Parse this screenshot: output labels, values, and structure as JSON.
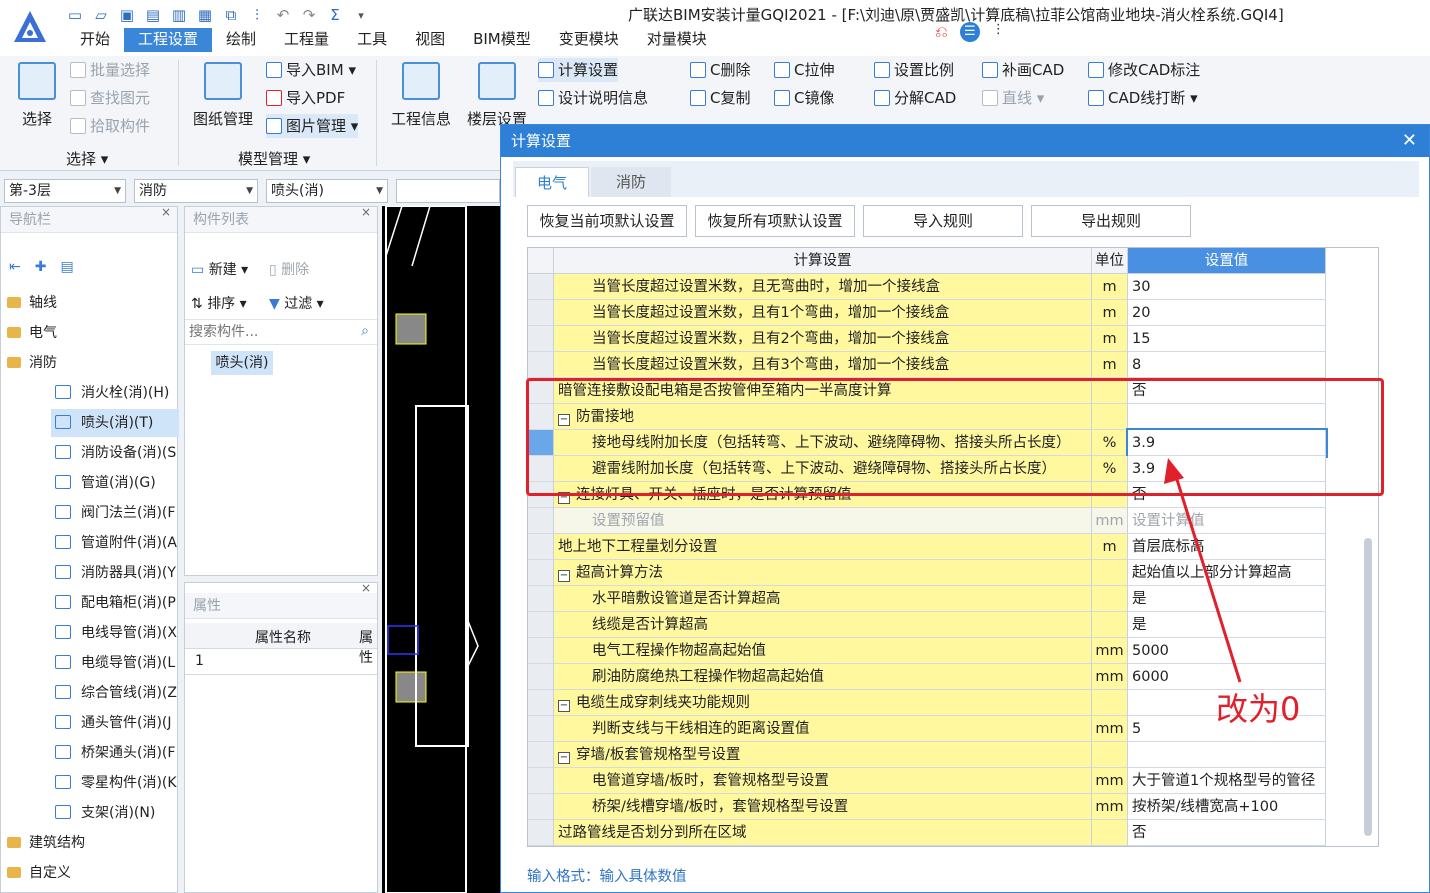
{
  "app": {
    "title": "广联达BIM安装计量GQI2021 - [F:\\刘迪\\原\\贾盛凯\\计算底稿\\拉菲公馆商业地块-消火栓系统.GQI4]",
    "menu_tabs": [
      "开始",
      "工程设置",
      "绘制",
      "工程量",
      "工具",
      "视图",
      "BIM模型",
      "变更模块",
      "对量模块"
    ]
  },
  "ribbon": {
    "select_group": {
      "big": "选择",
      "items": [
        "批量选择",
        "查找图元",
        "拾取构件"
      ],
      "label": "选择"
    },
    "model_group": {
      "big": "图纸管理",
      "items": [
        "导入BIM",
        "导入PDF",
        "图片管理"
      ],
      "label": "模型管理"
    },
    "info_buttons": [
      "工程信息",
      "楼层设置"
    ],
    "calc_items": [
      "计算设置",
      "设计说明信息"
    ],
    "cad_items": [
      "C删除",
      "C拉伸",
      "C复制",
      "C镜像"
    ],
    "scale_items": [
      "设置比例",
      "补画CAD",
      "修改CAD标注",
      "分解CAD",
      "直线",
      "CAD线打断"
    ]
  },
  "selectors": {
    "floor": "第-3层",
    "category": "消防",
    "component": "喷头(消)"
  },
  "nav": {
    "title": "导航栏",
    "folders": [
      "轴线",
      "电气",
      "消防",
      "建筑结构",
      "自定义"
    ],
    "items": [
      "消火栓(消)(H)",
      "喷头(消)(T)",
      "消防设备(消)(S",
      "管道(消)(G)",
      "阀门法兰(消)(F",
      "管道附件(消)(A",
      "消防器具(消)(Y",
      "配电箱柜(消)(P",
      "电线导管(消)(X",
      "电缆导管(消)(L",
      "综合管线(消)(Z",
      "通头管件(消)(J",
      "桥架通头(消)(F",
      "零星构件(消)(K",
      "支架(消)(N)"
    ]
  },
  "comp_list": {
    "title": "构件列表",
    "new": "新建",
    "delete": "删除",
    "sort": "排序",
    "filter": "过滤",
    "search_placeholder": "搜索构件...",
    "item": "喷头(消)"
  },
  "props": {
    "title": "属性",
    "col_name": "属性名称",
    "col_val": "属性",
    "row1": "1"
  },
  "dialog": {
    "title": "计算设置",
    "tabs": [
      "电气",
      "消防"
    ],
    "buttons": [
      "恢复当前项默认设置",
      "恢复所有项默认设置",
      "导入规则",
      "导出规则"
    ],
    "headers": [
      "计算设置",
      "单位",
      "设置值"
    ],
    "rows": [
      {
        "name": "当管长度超过设置米数，且无弯曲时，增加一个接线盒",
        "unit": "m",
        "value": "30",
        "indent": 2
      },
      {
        "name": "当管长度超过设置米数，且有1个弯曲，增加一个接线盒",
        "unit": "m",
        "value": "20",
        "indent": 2
      },
      {
        "name": "当管长度超过设置米数，且有2个弯曲，增加一个接线盒",
        "unit": "m",
        "value": "15",
        "indent": 2
      },
      {
        "name": "当管长度超过设置米数，且有3个弯曲，增加一个接线盒",
        "unit": "m",
        "value": "8",
        "indent": 2
      },
      {
        "name": "暗管连接敷设配电箱是否按管伸至箱内一半高度计算",
        "unit": "",
        "value": "否",
        "indent": 0
      },
      {
        "name": "防雷接地",
        "unit": "",
        "value": "",
        "indent": 0,
        "expand": true
      },
      {
        "name": "接地母线附加长度（包括转弯、上下波动、避绕障碍物、搭接头所占长度）",
        "unit": "%",
        "value": "3.9",
        "indent": 2,
        "selected": true
      },
      {
        "name": "避雷线附加长度（包括转弯、上下波动、避绕障碍物、搭接头所占长度）",
        "unit": "%",
        "value": "3.9",
        "indent": 2
      },
      {
        "name": "连接灯具、开关、插座时，是否计算预留值",
        "unit": "",
        "value": "否",
        "indent": 0,
        "expand": true
      },
      {
        "name": "设置预留值",
        "unit": "mm",
        "value": "设置计算值",
        "indent": 2,
        "gray": true
      },
      {
        "name": "地上地下工程量划分设置",
        "unit": "m",
        "value": "首层底标高",
        "indent": 0
      },
      {
        "name": "超高计算方法",
        "unit": "",
        "value": "起始值以上部分计算超高",
        "indent": 0,
        "expand": true
      },
      {
        "name": "水平暗敷设管道是否计算超高",
        "unit": "",
        "value": "是",
        "indent": 2
      },
      {
        "name": "线缆是否计算超高",
        "unit": "",
        "value": "是",
        "indent": 2
      },
      {
        "name": "电气工程操作物超高起始值",
        "unit": "mm",
        "value": "5000",
        "indent": 2
      },
      {
        "name": "刷油防腐绝热工程操作物超高起始值",
        "unit": "mm",
        "value": "6000",
        "indent": 2
      },
      {
        "name": "电缆生成穿刺线夹功能规则",
        "unit": "",
        "value": "",
        "indent": 0,
        "expand": true
      },
      {
        "name": "判断支线与干线相连的距离设置值",
        "unit": "mm",
        "value": "5",
        "indent": 2
      },
      {
        "name": "穿墙/板套管规格型号设置",
        "unit": "",
        "value": "",
        "indent": 0,
        "expand": true
      },
      {
        "name": "电管道穿墙/板时，套管规格型号设置",
        "unit": "mm",
        "value": "大于管道1个规格型号的管径",
        "indent": 2
      },
      {
        "name": "桥架/线槽穿墙/板时，套管规格型号设置",
        "unit": "mm",
        "value": "按桥架/线槽宽高+100",
        "indent": 2
      },
      {
        "name": "过路管线是否划分到所在区域",
        "unit": "",
        "value": "否",
        "indent": 0
      }
    ],
    "format_hint": "输入格式：输入具体数值"
  },
  "annotation": "改为0",
  "colors": {
    "accent": "#2e7fd6",
    "highlight": "#fff89f",
    "annotation": "#e0202a"
  }
}
